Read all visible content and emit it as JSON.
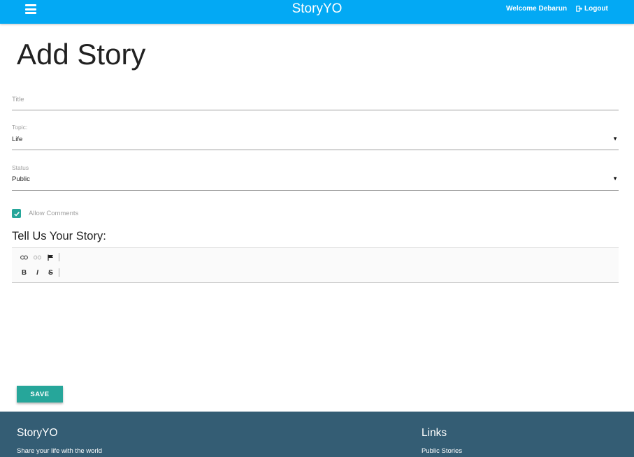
{
  "header": {
    "brand": "StoryYO",
    "welcome": "Welcome Debarun",
    "logout_label": "Logout",
    "bg_color": "#03a9f4"
  },
  "page": {
    "title": "Add Story"
  },
  "form": {
    "title_placeholder": "Title",
    "topic_label": "Topic:",
    "topic_value": "Life",
    "status_label": "Status",
    "status_value": "Public",
    "allow_comments_label": "Allow Comments",
    "allow_comments_checked": true,
    "story_heading": "Tell Us Your Story:",
    "save_label": "SAVE",
    "accent_color": "#26a69a"
  },
  "editor_toolbar": {
    "row1": [
      "link-icon",
      "unlink-icon",
      "anchor-flag-icon"
    ],
    "row2": [
      {
        "icon": "bold-icon",
        "glyph": "B"
      },
      {
        "icon": "italic-icon",
        "glyph": "I"
      },
      {
        "icon": "strikethrough-icon",
        "glyph": "S"
      }
    ]
  },
  "footer": {
    "title": "StoryYO",
    "tagline": "Share your life with the world",
    "links_title": "Links",
    "links": [
      "Public Stories"
    ],
    "bg_color": "#345d74"
  }
}
